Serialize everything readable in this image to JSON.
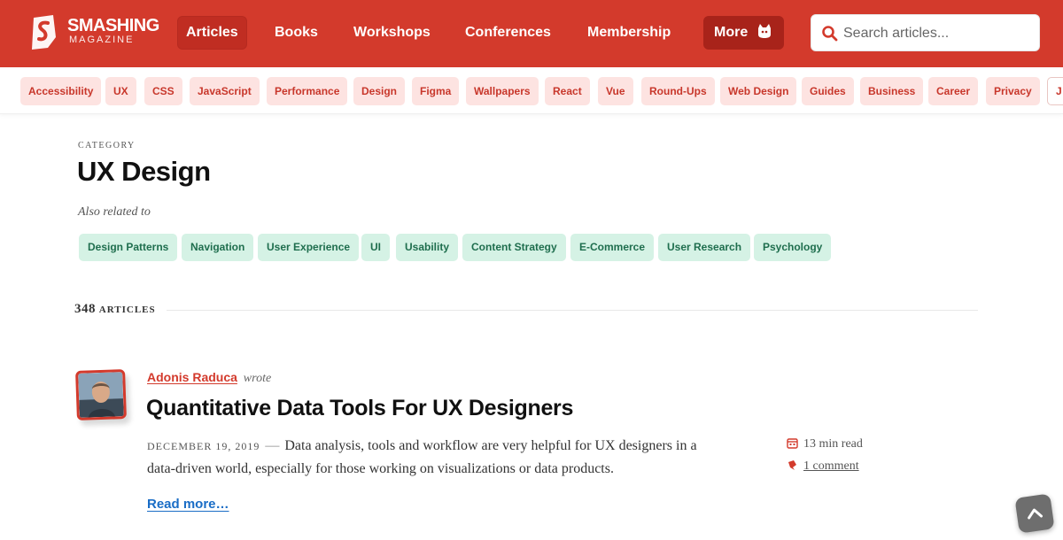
{
  "header": {
    "logo_title": "SMASHING",
    "logo_subtitle": "MAGAZINE",
    "nav": [
      {
        "label": "Articles"
      },
      {
        "label": "Books"
      },
      {
        "label": "Workshops"
      },
      {
        "label": "Conferences"
      },
      {
        "label": "Membership"
      },
      {
        "label": "More"
      }
    ],
    "search_placeholder": "Search articles...",
    "brand_color": "#d33a2c"
  },
  "tagbar": {
    "tags": [
      "Accessibility",
      "UX",
      "CSS",
      "JavaScript",
      "Performance",
      "Design",
      "Figma",
      "Wallpapers",
      "React",
      "Vue",
      "Round-Ups",
      "Web Design",
      "Guides",
      "Business",
      "Career",
      "Privacy"
    ],
    "partial_tag": "J"
  },
  "category": {
    "eyebrow": "CATEGORY",
    "title": "UX Design",
    "also_related": "Also related to",
    "related": [
      "Design Patterns",
      "Navigation",
      "User Experience",
      "UI",
      "Usability",
      "Content Strategy",
      "E-Commerce",
      "User Research",
      "Psychology"
    ]
  },
  "listing": {
    "count": "348",
    "count_label": "ARTICLES"
  },
  "article": {
    "author": "Adonis Raduca",
    "wrote": "wrote",
    "title": "Quantitative Data Tools For UX Designers",
    "date": "DECEMBER 19, 2019",
    "dash": "—",
    "excerpt": "Data analysis, tools and workflow are very helpful for UX designers in a data-driven world, especially for those working on visualizations or data products.",
    "read_time": "13 min read",
    "comments": "1 comment",
    "read_more": "Read more…"
  }
}
